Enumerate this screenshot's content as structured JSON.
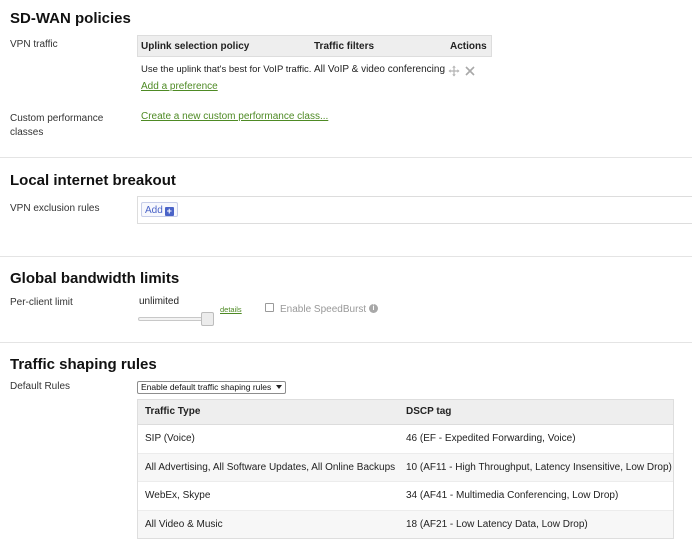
{
  "sdwan": {
    "title": "SD-WAN policies",
    "vpn_traffic_label": "VPN traffic",
    "table_headers": [
      "Uplink selection policy",
      "Traffic filters",
      "Actions"
    ],
    "policy_text": "Use the uplink that's best for VoIP traffic.",
    "filter_text": "All VoIP & video conferencing",
    "add_preference": "Add a preference",
    "custom_perf_label": "Custom performance classes",
    "create_class_link": "Create a new custom performance class..."
  },
  "breakout": {
    "title": "Local internet breakout",
    "exclusion_label": "VPN exclusion rules",
    "add_label": "Add",
    "add_plus": "+"
  },
  "bandwidth": {
    "title": "Global bandwidth limits",
    "per_client_label": "Per-client limit",
    "limit_value": "unlimited",
    "details_link": "details",
    "speedburst_label": "Enable SpeedBurst",
    "speedburst_checked": false,
    "slider_fraction": 1.0
  },
  "shaping": {
    "title": "Traffic shaping rules",
    "default_rules_label": "Default Rules",
    "default_rules_selected": "Enable default traffic shaping rules",
    "table_headers": [
      "Traffic Type",
      "DSCP tag"
    ],
    "rows": [
      {
        "type": "SIP (Voice)",
        "dscp": "46 (EF - Expedited Forwarding, Voice)"
      },
      {
        "type": "All Advertising, All Software Updates, All Online Backups",
        "dscp": "10 (AF11 - High Throughput, Latency Insensitive, Low Drop)"
      },
      {
        "type": "WebEx, Skype",
        "dscp": "34 (AF41 - Multimedia Conferencing, Low Drop)"
      },
      {
        "type": "All Video & Music",
        "dscp": "18 (AF21 - Low Latency Data, Low Drop)"
      }
    ]
  },
  "icons": {
    "move": "move-icon",
    "delete": "close-icon",
    "info": "info-icon",
    "caret": "chevron-down-icon"
  },
  "colors": {
    "link": "#4e8a24",
    "add_button": "#4a63c8",
    "header_bg": "#eeeeee"
  }
}
